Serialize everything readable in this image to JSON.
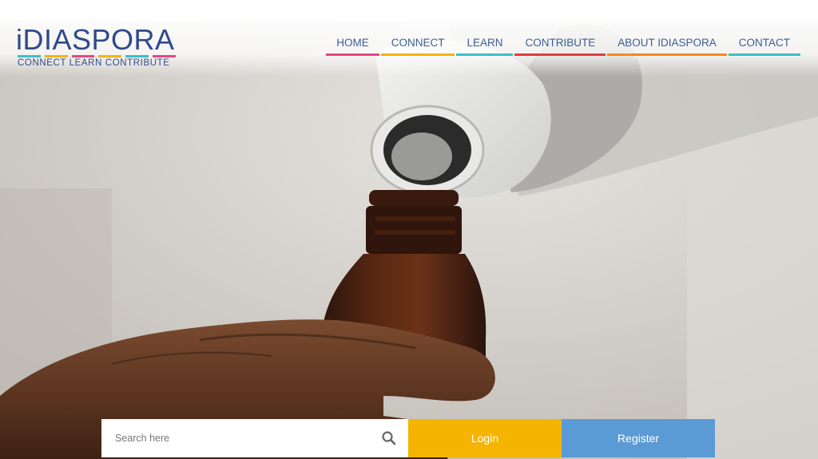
{
  "brand": {
    "name": "iDIASPORA",
    "tagline": "CONNECT LEARN CONTRIBUTE",
    "text_color": "#2f4a8a",
    "bar_colors": [
      "#3dbfc4",
      "#f4b400",
      "#e7477d",
      "#f4b400",
      "#3dbfc4",
      "#e7477d"
    ]
  },
  "nav": {
    "items": [
      {
        "label": "HOME",
        "color": "#e7477d"
      },
      {
        "label": "CONNECT",
        "color": "#f4b400"
      },
      {
        "label": "LEARN",
        "color": "#3dbfc4"
      },
      {
        "label": "CONTRIBUTE",
        "color": "#e23b3b"
      },
      {
        "label": "ABOUT IDIASPORA",
        "color": "#f4881e"
      },
      {
        "label": "CONTACT",
        "color": "#3dbfc4"
      }
    ]
  },
  "hero": {
    "image": "hand-pouring-medicine-bottle"
  },
  "search": {
    "placeholder": "Search here",
    "icon": "search-icon"
  },
  "actions": {
    "login_label": "Login",
    "register_label": "Register",
    "login_color": "#f4b400",
    "register_color": "#5b9bd5"
  }
}
